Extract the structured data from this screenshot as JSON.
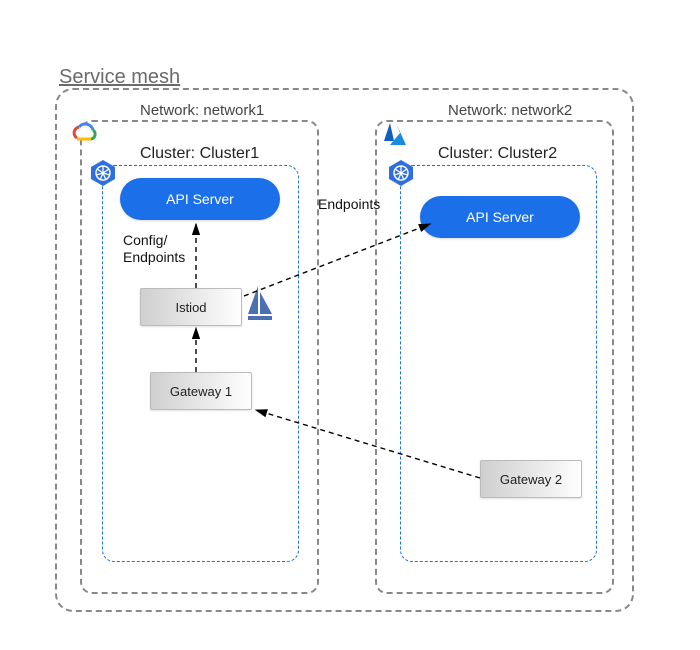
{
  "mesh": {
    "title": "Service mesh"
  },
  "networks": {
    "n1": {
      "label": "Network: network1"
    },
    "n2": {
      "label": "Network: network2"
    }
  },
  "clusters": {
    "c1": {
      "label": "Cluster: Cluster1",
      "provider": "gcp"
    },
    "c2": {
      "label": "Cluster: Cluster2",
      "provider": "azure"
    }
  },
  "nodes": {
    "api1": {
      "label": "API Server"
    },
    "api2": {
      "label": "API Server"
    },
    "istiod": {
      "label": "Istiod"
    },
    "gw1": {
      "label": "Gateway 1"
    },
    "gw2": {
      "label": "Gateway 2"
    }
  },
  "flows": {
    "config": {
      "label": "Config/\nEndpoints"
    },
    "endpoints": {
      "label": "Endpoints"
    }
  },
  "icons": {
    "gcp": "google-cloud-icon",
    "azure": "azure-icon",
    "k8s": "kubernetes-icon",
    "istio": "istio-icon"
  }
}
